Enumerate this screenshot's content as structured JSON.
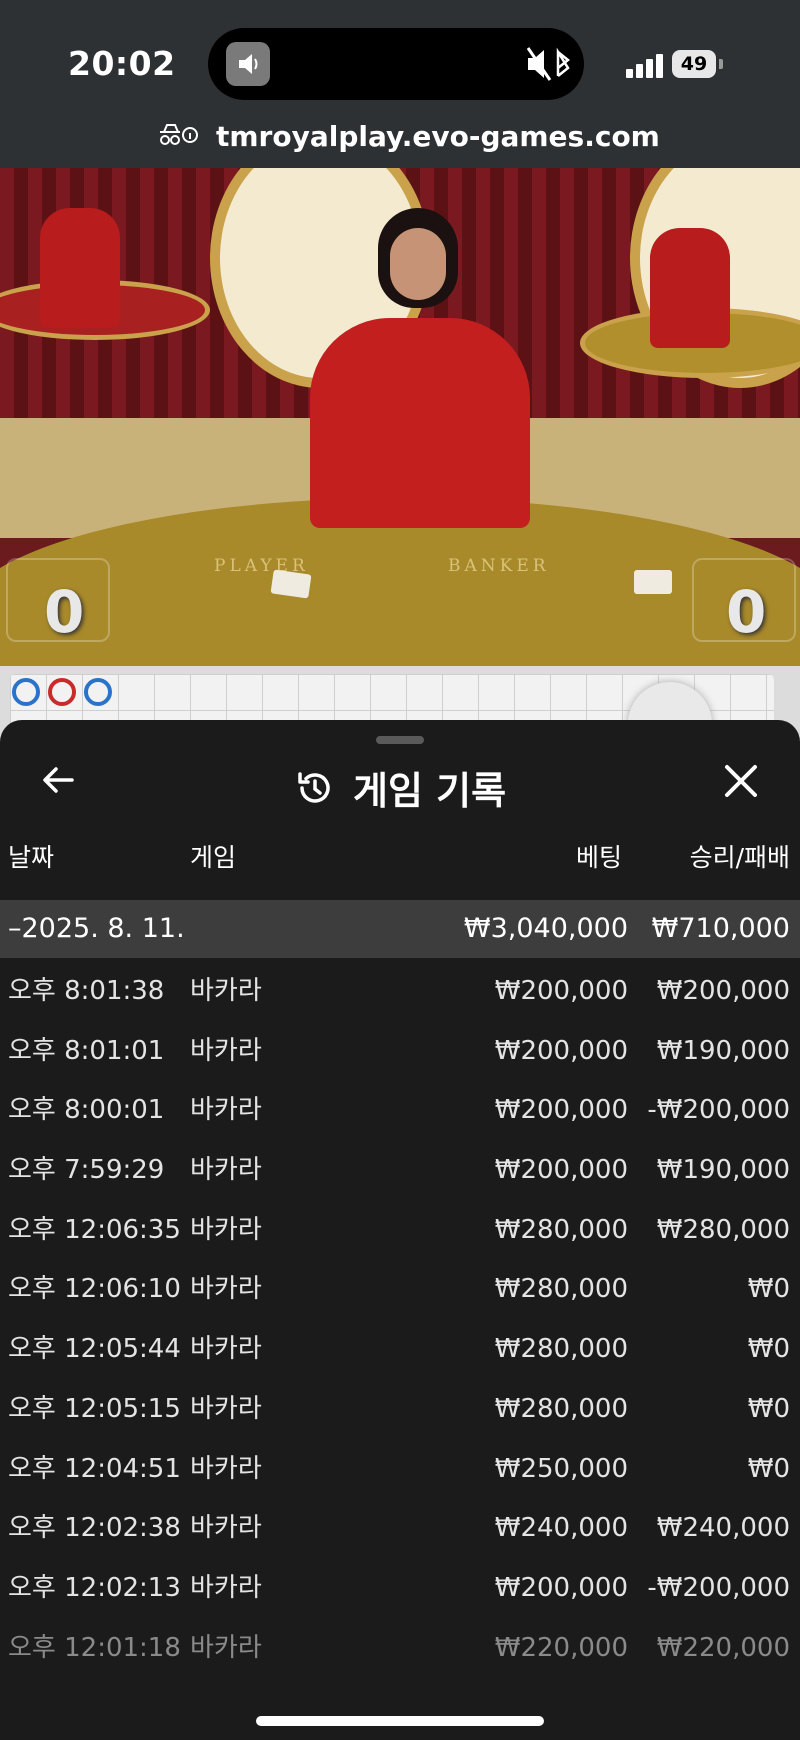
{
  "status_bar": {
    "time": "20:02",
    "battery": "49",
    "url": "tmroyalplay.evo-games.com",
    "icons": [
      "speaker-icon",
      "mute-icon",
      "bluetooth-icon",
      "signal-icon",
      "battery-icon",
      "incognito-icon",
      "info-icon"
    ]
  },
  "video": {
    "player_label": "PLAYER",
    "banker_label": "BANKER",
    "player_score": "0",
    "banker_score": "0"
  },
  "road": {
    "beads": [
      "#2a73c9",
      "#c92a2a",
      "#2a73c9"
    ]
  },
  "sheet": {
    "title": "게임 기록",
    "columns": {
      "date": "날짜",
      "game": "게임",
      "bet": "베팅",
      "win_loss": "승리/패배"
    },
    "summary": {
      "date": "–2025. 8. 11.",
      "bet": "₩3,040,000",
      "win_loss": "₩710,000"
    },
    "rows": [
      {
        "time": "오후 8:01:38",
        "game": "바카라",
        "bet": "₩200,000",
        "result": "₩200,000"
      },
      {
        "time": "오후 8:01:01",
        "game": "바카라",
        "bet": "₩200,000",
        "result": "₩190,000"
      },
      {
        "time": "오후 8:00:01",
        "game": "바카라",
        "bet": "₩200,000",
        "result": "-₩200,000"
      },
      {
        "time": "오후 7:59:29",
        "game": "바카라",
        "bet": "₩200,000",
        "result": "₩190,000"
      },
      {
        "time": "오후 12:06:35",
        "game": "바카라",
        "bet": "₩280,000",
        "result": "₩280,000"
      },
      {
        "time": "오후 12:06:10",
        "game": "바카라",
        "bet": "₩280,000",
        "result": "₩0"
      },
      {
        "time": "오후 12:05:44",
        "game": "바카라",
        "bet": "₩280,000",
        "result": "₩0"
      },
      {
        "time": "오후 12:05:15",
        "game": "바카라",
        "bet": "₩280,000",
        "result": "₩0"
      },
      {
        "time": "오후 12:04:51",
        "game": "바카라",
        "bet": "₩250,000",
        "result": "₩0"
      },
      {
        "time": "오후 12:02:38",
        "game": "바카라",
        "bet": "₩240,000",
        "result": "₩240,000"
      },
      {
        "time": "오후 12:02:13",
        "game": "바카라",
        "bet": "₩200,000",
        "result": "-₩200,000"
      },
      {
        "time": "오후 12:01:18",
        "game": "바카라",
        "bet": "₩220,000",
        "result": "₩220,000"
      }
    ]
  }
}
